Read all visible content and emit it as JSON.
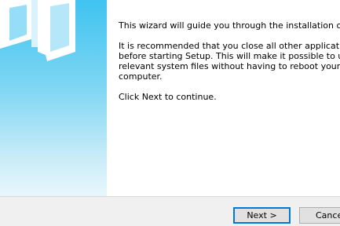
{
  "content": {
    "intro": "This wizard will guide you through the installation of Postbox",
    "recommendation_lines": [
      "It is recommended that you close all other applications",
      "before starting Setup. This will make it possible to update",
      "relevant system files without having to reboot your",
      "computer."
    ],
    "continue_text": "Click Next to continue."
  },
  "buttons": {
    "next_label": "Next >",
    "cancel_label": "Cancel"
  },
  "colors": {
    "sidebar_top": "#3fc3f0",
    "sidebar_bottom": "#e8f6fb",
    "default_button_border": "#0078d7"
  }
}
